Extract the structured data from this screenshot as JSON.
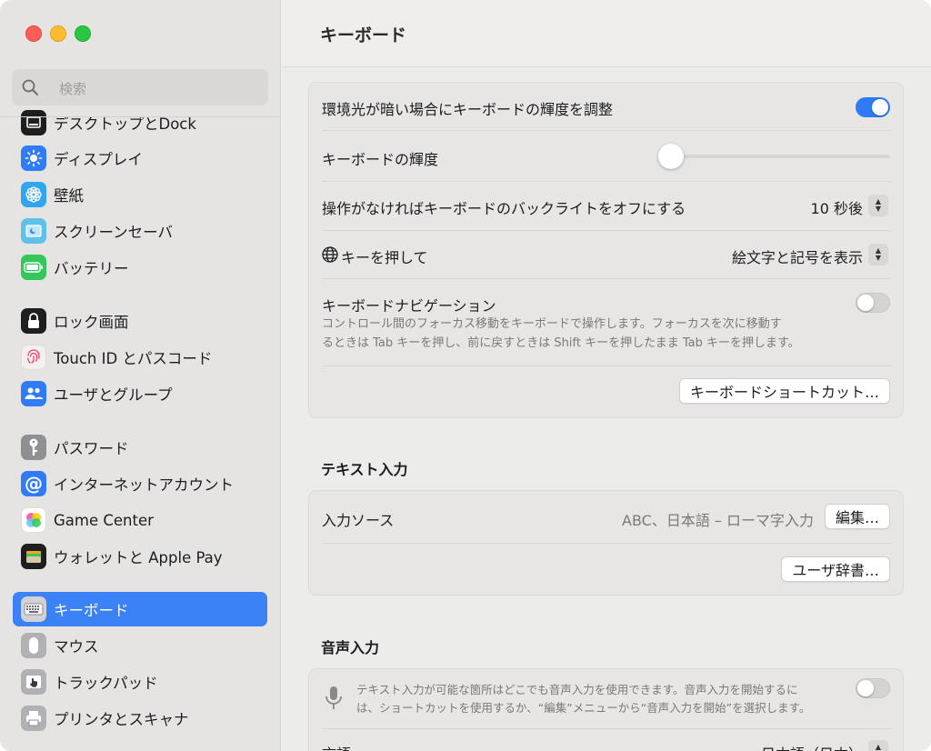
{
  "window": {
    "title": "キーボード"
  },
  "search": {
    "placeholder": "検索"
  },
  "sidebar": {
    "items": [
      {
        "label": "デスクトップとDock",
        "icon": "dock-icon",
        "color": "#1e1e1e"
      },
      {
        "label": "ディスプレイ",
        "icon": "display-icon",
        "color": "#2f7cf6"
      },
      {
        "label": "壁紙",
        "icon": "wallpaper-icon",
        "color": "#32a5f0"
      },
      {
        "label": "スクリーンセーバ",
        "icon": "screensaver-icon",
        "color": "#5fc1e8"
      },
      {
        "label": "バッテリー",
        "icon": "battery-icon",
        "color": "#34c759"
      },
      {
        "label": "ロック画面",
        "icon": "lock-icon",
        "color": "#1e1e1e"
      },
      {
        "label": "Touch ID とパスコード",
        "icon": "fingerprint-icon",
        "color": "#f2f1f0"
      },
      {
        "label": "ユーザとグループ",
        "icon": "users-icon",
        "color": "#2f7cf6"
      },
      {
        "label": "パスワード",
        "icon": "key-icon",
        "color": "#8e8e93"
      },
      {
        "label": "インターネットアカウント",
        "icon": "at-icon",
        "color": "#2f7cf6"
      },
      {
        "label": "Game Center",
        "icon": "game-center-icon",
        "color": "#ffffff"
      },
      {
        "label": "ウォレットと Apple Pay",
        "icon": "wallet-icon",
        "color": "#1e1e1e"
      },
      {
        "label": "キーボード",
        "icon": "keyboard-icon",
        "color": "#b0b0b5"
      },
      {
        "label": "マウス",
        "icon": "mouse-icon",
        "color": "#b0b0b5"
      },
      {
        "label": "トラックパッド",
        "icon": "trackpad-icon",
        "color": "#b0b0b5"
      },
      {
        "label": "プリンタとスキャナ",
        "icon": "printer-icon",
        "color": "#b0b0b5"
      }
    ],
    "selected_index": 12
  },
  "keyboard": {
    "ambient_label": "環境光が暗い場合にキーボードの輝度を調整",
    "ambient_on": true,
    "brightness_label": "キーボードの輝度",
    "brightness_value": 0.0,
    "backlight_label": "操作がなければキーボードのバックライトをオフにする",
    "backlight_value": "10 秒後",
    "globe_label": "キーを押して",
    "globe_value": "絵文字と記号を表示",
    "nav_label": "キーボードナビゲーション",
    "nav_desc_line1": "コントロール間のフォーカス移動をキーボードで操作します。フォーカスを次に移動す",
    "nav_desc_line2": "るときは Tab キーを押し、前に戻すときは Shift キーを押したまま Tab キーを押します。",
    "nav_on": false,
    "shortcuts_button": "キーボードショートカット…"
  },
  "text_input": {
    "title": "テキスト入力",
    "sources_label": "入力ソース",
    "sources_value": "ABC、日本語 – ローマ字入力",
    "edit_button": "編集…",
    "dictionary_button": "ユーザ辞書…"
  },
  "dictation": {
    "title": "音声入力",
    "desc_line1": "テキスト入力が可能な箇所はどこでも音声入力を使用できます。音声入力を開始するに",
    "desc_line2": "は、ショートカットを使用するか、“編集”メニューから“音声入力を開始”を選択します。",
    "enabled": false,
    "language_label": "言語",
    "language_value": "日本語（日本）"
  }
}
